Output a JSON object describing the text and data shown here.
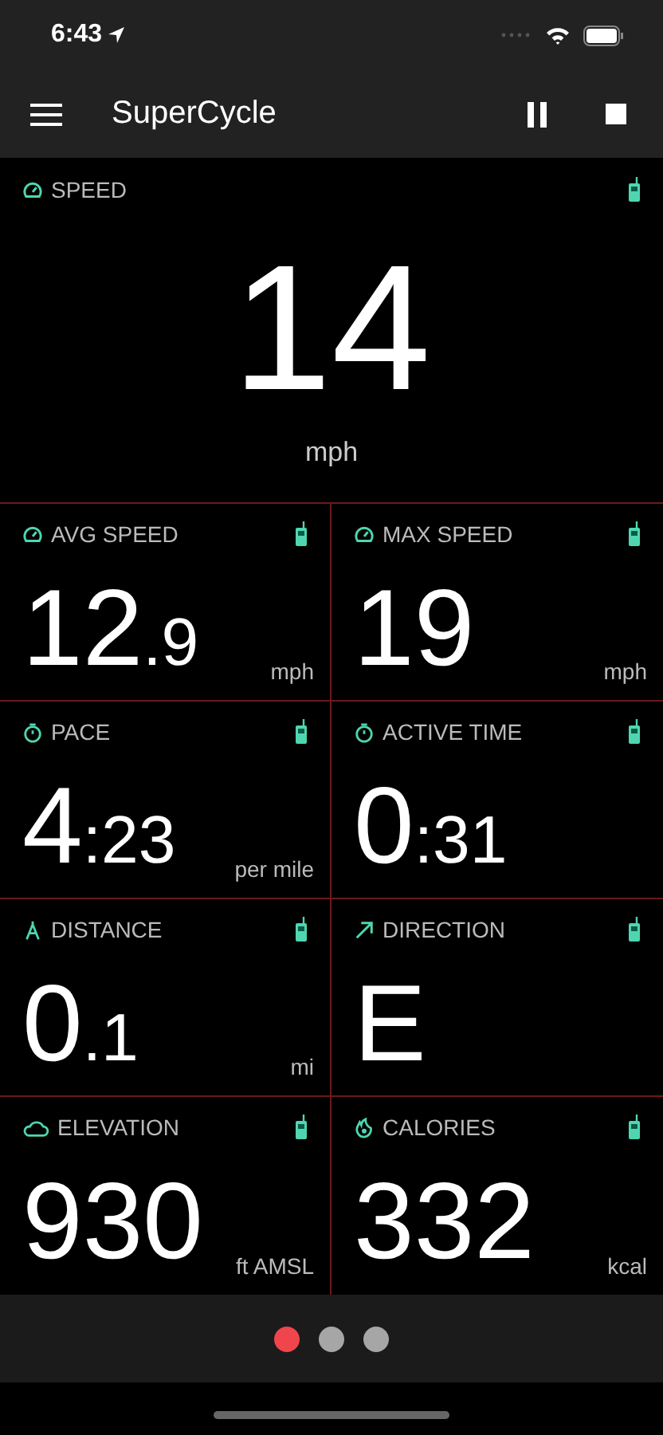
{
  "status_bar": {
    "time": "6:43"
  },
  "nav": {
    "title": "SuperCycle"
  },
  "main_metric": {
    "kind": "speed",
    "label": "SPEED",
    "value": "14",
    "unit": "mph"
  },
  "metrics": [
    {
      "kind": "speed",
      "label": "AVG SPEED",
      "value": "12",
      "fraction": ".9",
      "unit": "mph"
    },
    {
      "kind": "speed",
      "label": "MAX SPEED",
      "value": "19",
      "unit": "mph"
    },
    {
      "kind": "timer",
      "label": "PACE",
      "value": "4",
      "fraction": ":23",
      "unit": "per mile"
    },
    {
      "kind": "timer",
      "label": "ACTIVE TIME",
      "value": "0",
      "fraction": ":31"
    },
    {
      "kind": "distance",
      "label": "DISTANCE",
      "value": "0",
      "fraction": ".1",
      "unit": "mi"
    },
    {
      "kind": "direction",
      "label": "DIRECTION",
      "value": "E"
    },
    {
      "kind": "elevation",
      "label": "ELEVATION",
      "value": "930",
      "unit": "ft AMSL"
    },
    {
      "kind": "calories",
      "label": "CALORIES",
      "value": "332",
      "unit": "kcal"
    }
  ],
  "pages": [
    {
      "selected": true
    },
    {
      "selected": false
    },
    {
      "selected": false
    }
  ]
}
